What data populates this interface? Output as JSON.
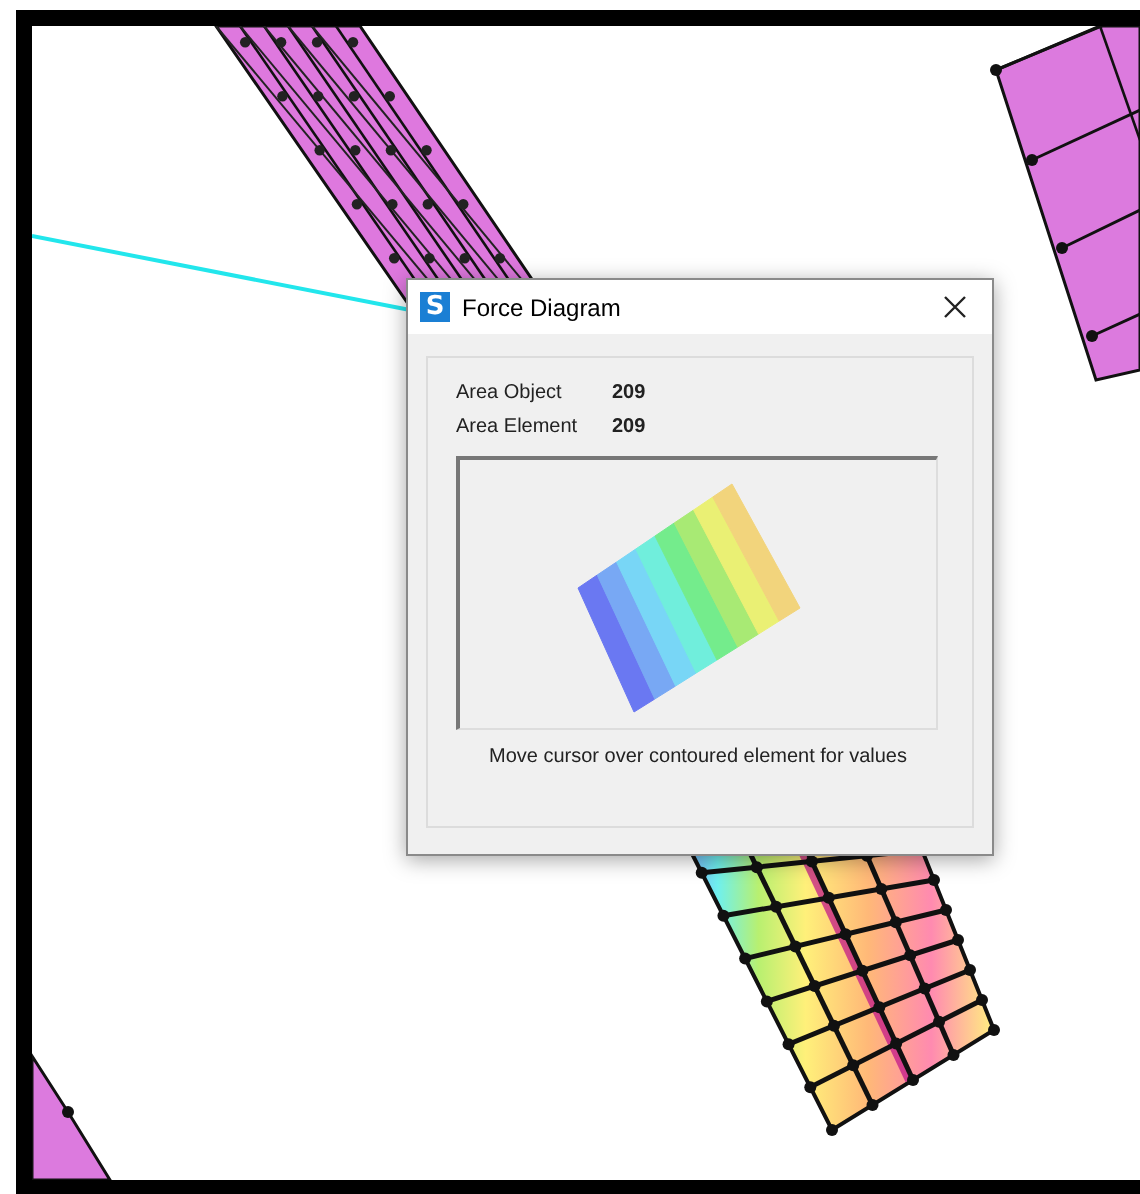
{
  "dialog": {
    "logo": "S",
    "title": "Force Diagram",
    "fields": [
      {
        "label": "Area Object",
        "value": "209"
      },
      {
        "label": "Area Element",
        "value": "209"
      }
    ],
    "hint": "Move cursor over contoured element for values"
  }
}
